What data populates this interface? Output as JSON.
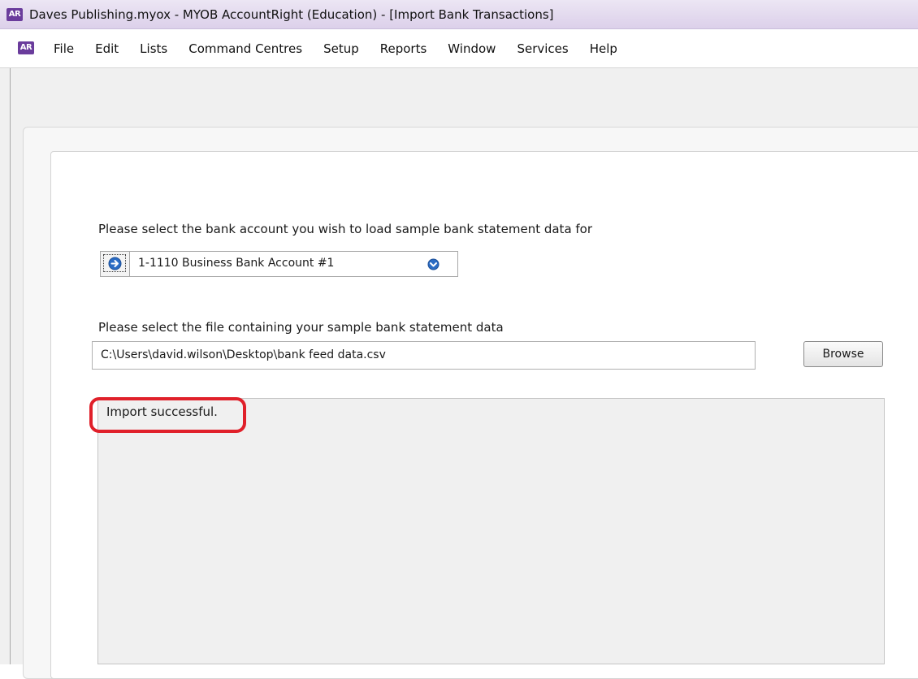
{
  "window": {
    "app_badge": "AR",
    "title": "Daves Publishing.myox - MYOB AccountRight (Education) - [Import Bank Transactions]"
  },
  "menu": {
    "items": [
      {
        "label": "File"
      },
      {
        "label": "Edit"
      },
      {
        "label": "Lists"
      },
      {
        "label": "Command Centres"
      },
      {
        "label": "Setup"
      },
      {
        "label": "Reports"
      },
      {
        "label": "Window"
      },
      {
        "label": "Services"
      },
      {
        "label": "Help"
      }
    ]
  },
  "form": {
    "account_prompt": "Please select the bank account you wish to load sample bank statement data for",
    "account_value": "1-1110 Business Bank Account #1",
    "file_prompt": "Please select the file containing your sample bank statement data",
    "file_path": "C:\\Users\\david.wilson\\Desktop\\bank feed data.csv",
    "browse_label": "Browse",
    "status_message": "Import successful."
  },
  "icons": {
    "account_arrow": "arrow-right-circle-icon",
    "account_dropdown": "chevron-down-circle-icon"
  },
  "colors": {
    "icon_blue": "#2b6cc4",
    "titlebar_purple": "#dcd0ea",
    "badge_purple": "#6a3c9c",
    "highlight_red": "#e0202a"
  }
}
